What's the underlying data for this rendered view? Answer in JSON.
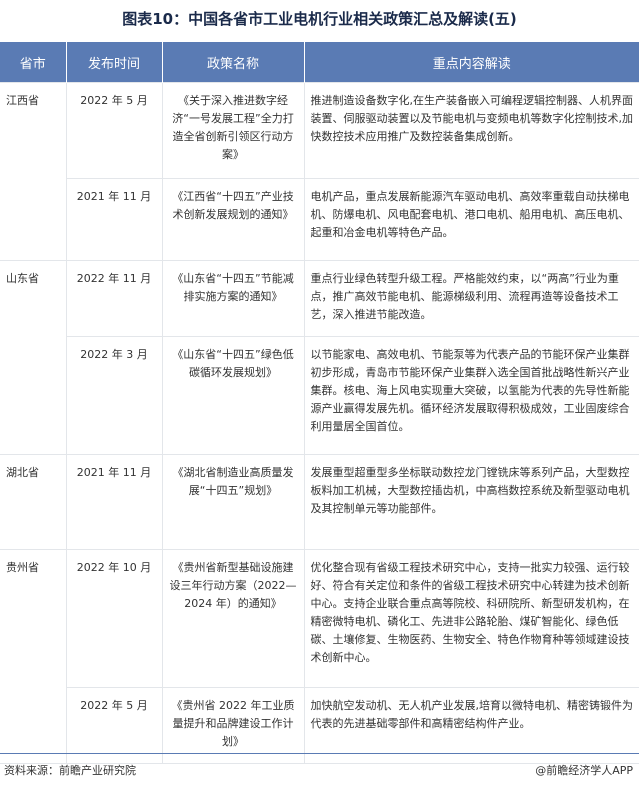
{
  "title": "图表10：中国各省市工业电机行业相关政策汇总及解读(五)",
  "headers": [
    "省市",
    "发布时间",
    "政策名称",
    "重点内容解读"
  ],
  "rows": [
    {
      "province": "江西省",
      "date": "2022 年 5 月",
      "name": "《关于深入推进数字经济“一号发展工程”全力打造全省创新引领区行动方案》",
      "content": "推进制造设备数字化,在生产装备嵌入可编程逻辑控制器、人机界面装置、伺服驱动装置以及节能电机与变频电机等数字化控制技术,加快数控技术应用推广及数控装备集成创新。"
    },
    {
      "province": "",
      "date": "2021 年 11 月",
      "name": "《江西省“十四五”产业技术创新发展规划的通知》",
      "content": "电机产品，重点发展新能源汽车驱动电机、高效率重载自动扶梯电机、防爆电机、风电配套电机、港口电机、船用电机、高压电机、起重和冶金电机等特色产品。"
    },
    {
      "province": "山东省",
      "date": "2022 年 11 月",
      "name": "《山东省“十四五”节能减排实施方案的通知》",
      "content": "重点行业绿色转型升级工程。严格能效约束，以“两高”行业为重点，推广高效节能电机、能源梯级利用、流程再造等设备技术工艺，深入推进节能改造。"
    },
    {
      "province": "",
      "date": "2022 年 3 月",
      "name": "《山东省“十四五”绿色低碳循环发展规划》",
      "content": "以节能家电、高效电机、节能泵等为代表产品的节能环保产业集群初步形成，青岛市节能环保产业集群入选全国首批战略性新兴产业集群。核电、海上风电实现重大突破，以氢能为代表的先导性新能源产业赢得发展先机。循环经济发展取得积极成效，工业固废综合利用量居全国首位。"
    },
    {
      "province": "湖北省",
      "date": "2021 年 11 月",
      "name": "《湖北省制造业高质量发展“十四五”规划》",
      "content": "发展重型超重型多坐标联动数控龙门镗铣床等系列产品，大型数控板料加工机械，大型数控插齿机，中高档数控系统及新型驱动电机及其控制单元等功能部件。"
    },
    {
      "province": "贵州省",
      "date": "2022 年 10 月",
      "name": "《贵州省新型基础设施建设三年行动方案（2022—2024 年）的通知》",
      "content": "优化整合现有省级工程技术研究中心，支持一批实力较强、运行较好、符合有关定位和条件的省级工程技术研究中心转建为技术创新中心。支持企业联合重点高等院校、科研院所、新型研发机构，在精密微特电机、磷化工、先进非公路轮胎、煤矿智能化、绿色低碳、土壤修复、生物医药、生物安全、特色作物育种等领域建设技术创新中心。"
    },
    {
      "province": "",
      "date": "2022 年 5 月",
      "name": "《贵州省 2022 年工业质量提升和品牌建设工作计划》",
      "content": "加快航空发动机、无人机产业发展,培育以微特电机、精密铸锻件为代表的先进基础零部件和高精密结构件产业。"
    }
  ],
  "footer": {
    "source": "资料来源：前瞻产业研究院",
    "credit": "@前瞻经济学人APP"
  }
}
